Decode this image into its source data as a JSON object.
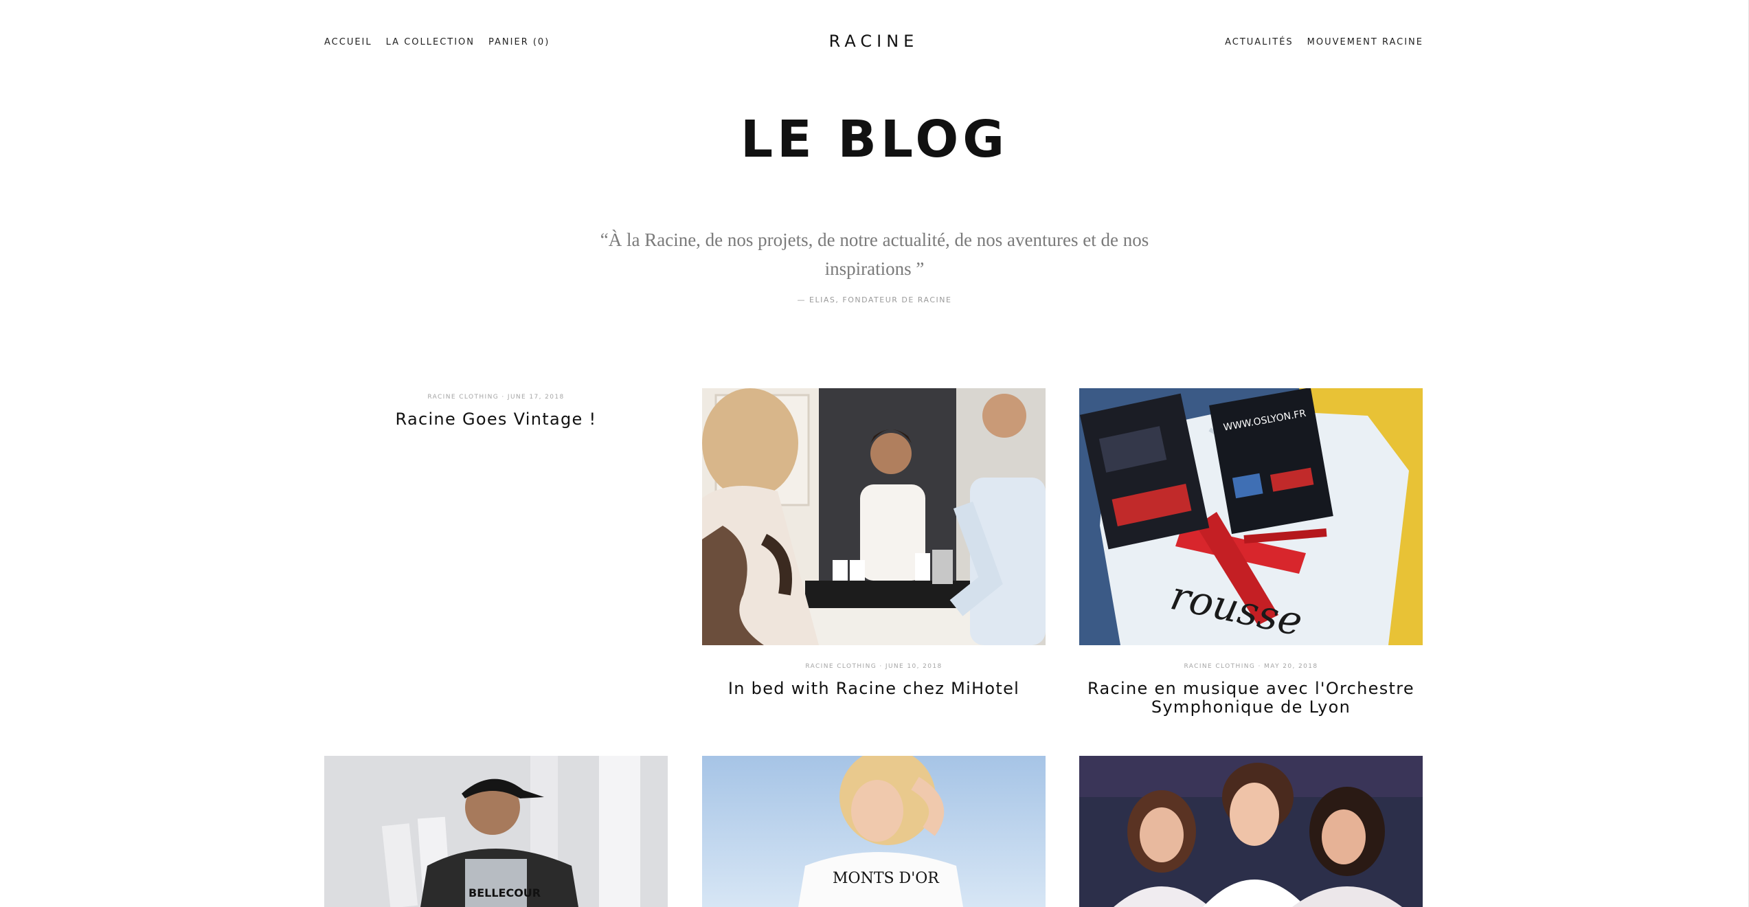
{
  "nav": {
    "left": [
      "ACCUEIL",
      "LA COLLECTION",
      "PANIER (0)"
    ],
    "brand": "RACINE",
    "right": [
      "ACTUALITÉS",
      "MOUVEMENT RACINE"
    ]
  },
  "hero": {
    "title": "LE BLOG",
    "quote": "“À la Racine, de nos projets, de notre actualité, de nos aventures et de nos inspirations ”",
    "author": "— ELIAS, FONDATEUR DE RACINE"
  },
  "posts": [
    {
      "meta": "RACINE CLOTHING · JUNE 17, 2018",
      "title": "Racine Goes Vintage !"
    },
    {
      "meta": "RACINE CLOTHING · JUNE 10, 2018",
      "title": "In bed with Racine chez MiHotel"
    },
    {
      "meta": "RACINE CLOTHING · MAY 20, 2018",
      "title": "Racine en musique avec l'Orchestre Symphonique de Lyon"
    }
  ],
  "images": {
    "post2_caption": "",
    "tshirt_brand_text": "rousse",
    "flyer_url": "WWW.OSLYON.FR",
    "row2_shirt1": "BELLECOUR",
    "row2_shirt2": "MONTS D'OR"
  }
}
